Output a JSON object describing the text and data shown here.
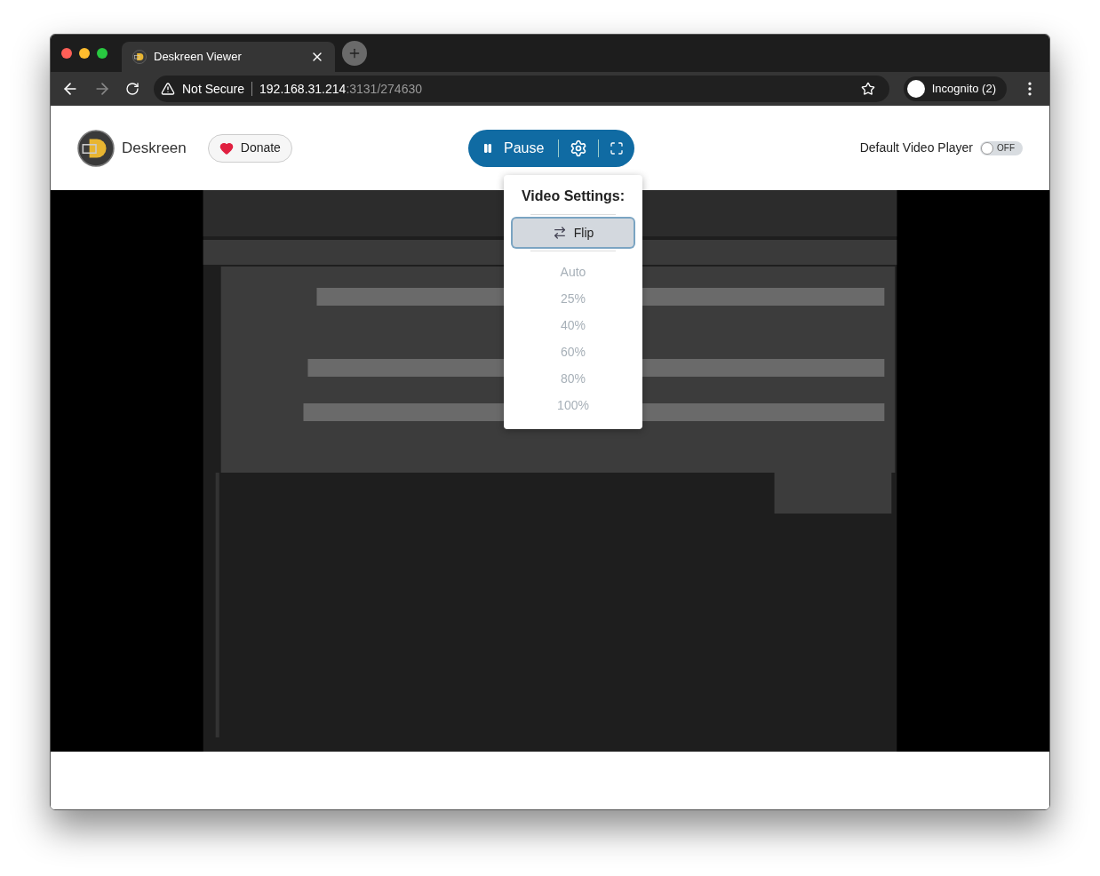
{
  "tab": {
    "title": "Deskreen Viewer",
    "selected": true
  },
  "address_bar": {
    "security": "Not Secure",
    "host": "192.168.31.214",
    "path": ":3131/274630"
  },
  "profile": {
    "label": "Incognito (2)"
  },
  "header": {
    "app_name": "Deskreen",
    "donate": "Donate",
    "controls": {
      "pause": "Pause"
    },
    "default_player": {
      "label": "Default Video Player",
      "on": false,
      "state_text": "OFF"
    }
  },
  "video_settings": {
    "title": "Video Settings:",
    "flip": {
      "label": "Flip",
      "selected": true
    },
    "quality": [
      {
        "label": "Auto",
        "disabled": true
      },
      {
        "label": "25%",
        "disabled": true
      },
      {
        "label": "40%",
        "disabled": true
      },
      {
        "label": "60%",
        "disabled": true
      },
      {
        "label": "80%",
        "disabled": true
      },
      {
        "label": "100%",
        "disabled": true
      }
    ]
  }
}
